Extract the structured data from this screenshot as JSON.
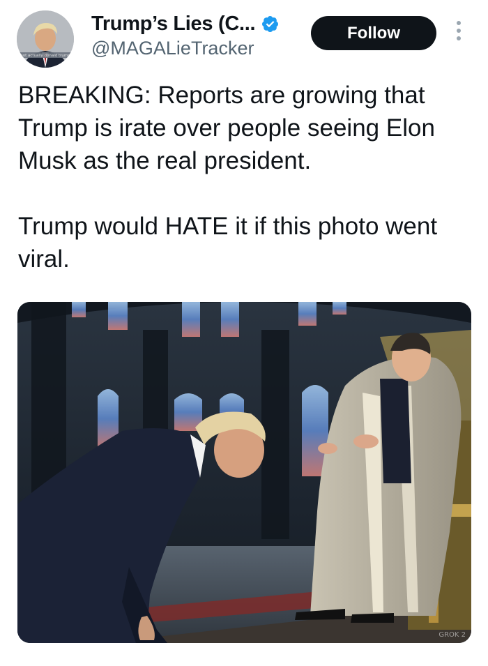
{
  "author": {
    "display_name": "Trump’s Lies (C...",
    "handle": "@MAGALieTracker",
    "verified": true,
    "avatar_caption": "not actually donald trump"
  },
  "follow_button": {
    "label": "Follow"
  },
  "tweet": {
    "paragraphs": [
      "BREAKING: Reports are growing that Trump is irate over people seeing Elon Musk as the real president.",
      "Trump would HATE it if this photo went viral."
    ]
  },
  "media": {
    "watermark": "GROK 2"
  },
  "colors": {
    "text": "#0f1419",
    "handle": "#536471",
    "button": "#0f1419",
    "verified": "#1d9bf0"
  }
}
